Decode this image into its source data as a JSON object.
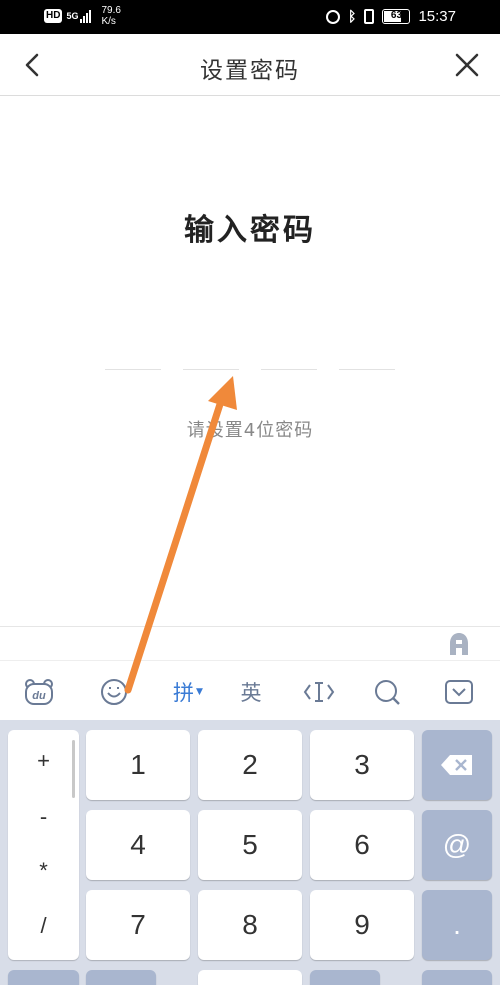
{
  "status_bar": {
    "network_badge": "HD",
    "network_type": "5G",
    "speed_value": "79.6",
    "speed_unit": "K/s",
    "battery_level": "63",
    "time": "15:37"
  },
  "header": {
    "title": "设置密码",
    "back_icon": "chevron-left-icon",
    "close_icon": "close-icon"
  },
  "main": {
    "heading": "输入密码",
    "pin_length": 4,
    "hint": "请设置4位密码"
  },
  "keyboard": {
    "toolbar": [
      {
        "name": "du-bear-icon",
        "kind": "icon"
      },
      {
        "name": "emoji-icon",
        "kind": "icon"
      },
      {
        "name": "pinyin-mode",
        "label": "拼",
        "kind": "text"
      },
      {
        "name": "english-mode",
        "label": "英",
        "kind": "text"
      },
      {
        "name": "cursor-icon",
        "kind": "icon"
      },
      {
        "name": "search-icon",
        "kind": "icon"
      },
      {
        "name": "hide-keyboard-icon",
        "kind": "icon"
      }
    ],
    "symbols": [
      "+",
      "-",
      "*",
      "/"
    ],
    "digits": [
      "1",
      "2",
      "3",
      "4",
      "5",
      "6",
      "7",
      "8",
      "9"
    ],
    "function_keys": [
      "backspace-icon",
      "@",
      "."
    ],
    "accent_color": "#3a7bd5",
    "key_color": "#ffffff",
    "function_key_color": "#a9b6cf"
  },
  "annotation": {
    "color": "#f0893a"
  }
}
